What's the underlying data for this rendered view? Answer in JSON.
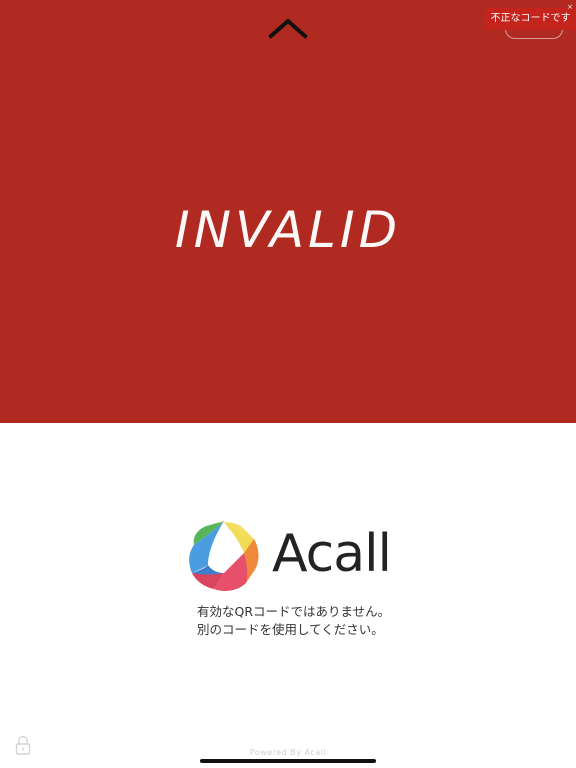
{
  "status": {
    "headline": "INVALID",
    "panel_color": "#b02a22"
  },
  "toast": {
    "text": "不正なコードです",
    "close_glyph": "×",
    "background_color": "#c4241c"
  },
  "nav": {
    "collapse_icon": "chevron-up-icon"
  },
  "brand": {
    "name": "Acall",
    "logo_icon": "acall-logo-icon",
    "logo_colors": [
      "#4a9de0",
      "#3d7fc9",
      "#58b55c",
      "#f2dc55",
      "#ef8a3c",
      "#e84f6a"
    ]
  },
  "message": {
    "line1": "有効なQRコードではありません。",
    "line2": "別のコードを使用してください。"
  },
  "footer": {
    "powered_by": "Powered By Acall",
    "lock_icon": "lock-icon"
  }
}
